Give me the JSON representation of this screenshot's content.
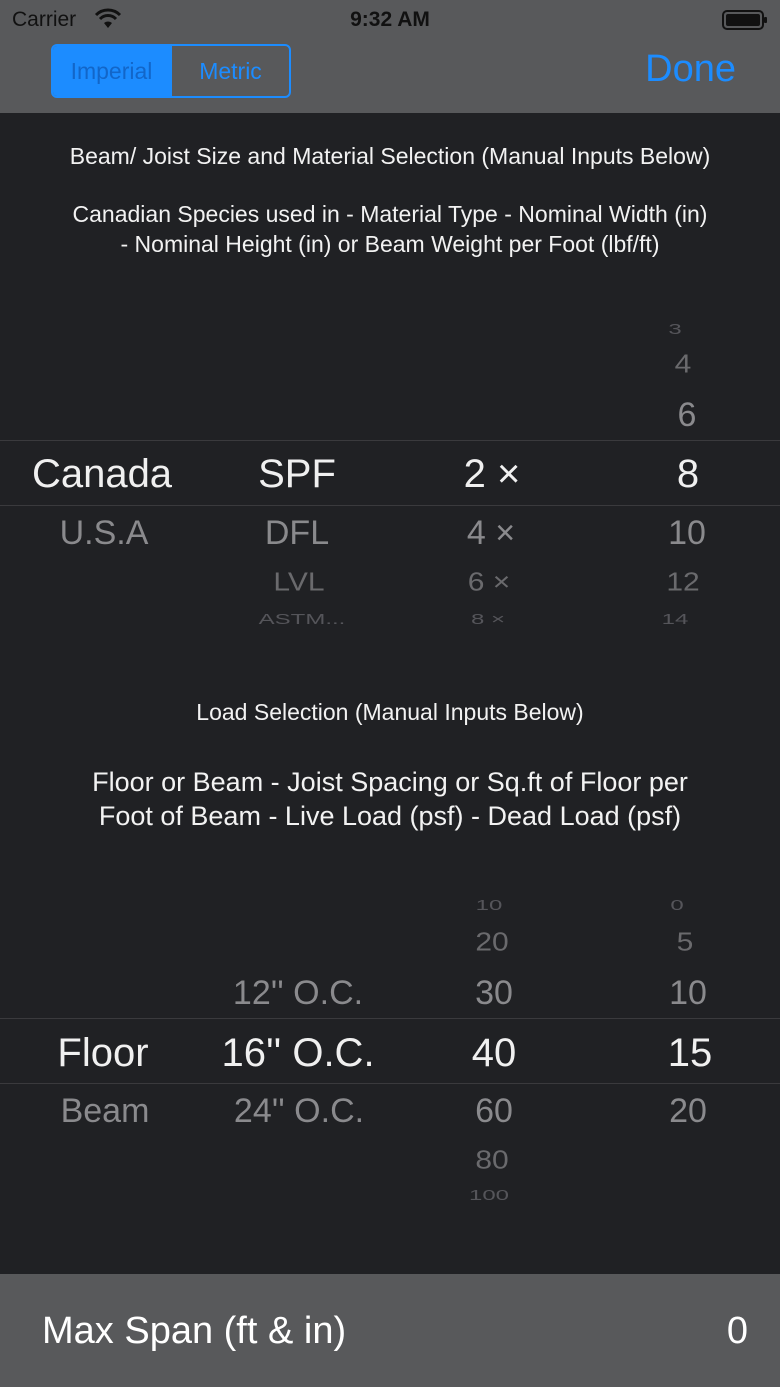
{
  "status_bar": {
    "carrier": "Carrier",
    "time": "9:32 AM",
    "icons": [
      "wifi-icon",
      "battery-icon"
    ]
  },
  "nav": {
    "segments": [
      "Imperial",
      "Metric"
    ],
    "selected_segment": "Imperial",
    "done_label": "Done",
    "accent_color": "#1c8cff"
  },
  "beam_section": {
    "title": "Beam/ Joist Size and Material Selection (Manual Inputs Below)",
    "subtitle_line1": "Canadian Species used in - Material Type - Nominal Width (in)",
    "subtitle_line2": "- Nominal Height (in) or Beam Weight per Foot (lbf/ft)",
    "picker": {
      "country": {
        "selected": "Canada",
        "below": [
          "U.S.A"
        ]
      },
      "material": {
        "selected": "SPF",
        "below": [
          "DFL",
          "LVL",
          "ASTM..."
        ]
      },
      "width": {
        "selected": "2 ×",
        "below": [
          "4 ×",
          "6 ×",
          "8 ×"
        ]
      },
      "height": {
        "above": [
          "3",
          "4",
          "6"
        ],
        "selected": "8",
        "below": [
          "10",
          "12",
          "14"
        ]
      }
    }
  },
  "load_section": {
    "title": "Load Selection (Manual Inputs Below)",
    "subtitle_line1": "Floor or Beam - Joist Spacing or Sq.ft of Floor per",
    "subtitle_line2": "Foot of Beam - Live Load (psf) - Dead Load (psf)",
    "picker": {
      "type": {
        "selected": "Floor",
        "below": [
          "Beam"
        ]
      },
      "spacing": {
        "above": [
          "12'' O.C."
        ],
        "selected": "16'' O.C.",
        "below": [
          "24'' O.C."
        ]
      },
      "live_load": {
        "above": [
          "10",
          "20",
          "30"
        ],
        "selected": "40",
        "below": [
          "60",
          "80",
          "100"
        ]
      },
      "dead_load": {
        "above": [
          "0",
          "5",
          "10"
        ],
        "selected": "15",
        "below": [
          "20"
        ]
      }
    }
  },
  "result": {
    "label": "Max Span (ft & in)",
    "value": "0"
  }
}
